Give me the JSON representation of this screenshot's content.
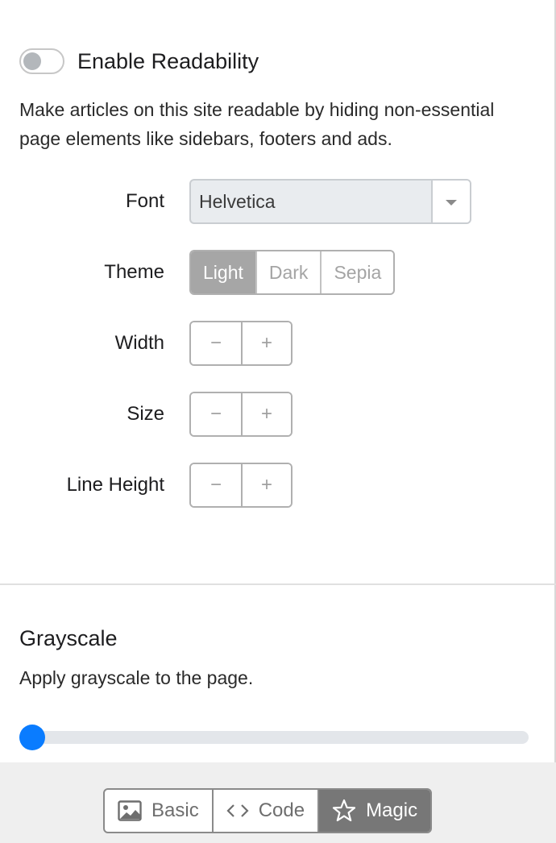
{
  "readability": {
    "toggle_label": "Enable Readability",
    "enabled": false,
    "description": "Make articles on this site readable by hiding non-essential page elements like sidebars, footers and ads.",
    "font": {
      "label": "Font",
      "value": "Helvetica"
    },
    "theme": {
      "label": "Theme",
      "options": [
        "Light",
        "Dark",
        "Sepia"
      ],
      "selected": "Light"
    },
    "width": {
      "label": "Width",
      "minus": "−",
      "plus": "+"
    },
    "size": {
      "label": "Size",
      "minus": "−",
      "plus": "+"
    },
    "line_height": {
      "label": "Line Height",
      "minus": "−",
      "plus": "+"
    }
  },
  "grayscale": {
    "title": "Grayscale",
    "description": "Apply grayscale to the page.",
    "level": 0
  },
  "footer": {
    "modes": [
      {
        "label": "Basic",
        "icon": "image-icon"
      },
      {
        "label": "Code",
        "icon": "code-icon"
      },
      {
        "label": "Magic",
        "icon": "star-icon"
      }
    ],
    "selected": "Magic"
  },
  "colors": {
    "accent": "#0a7cff",
    "active_segment": "#a6a6a6",
    "active_mode": "#777777"
  }
}
